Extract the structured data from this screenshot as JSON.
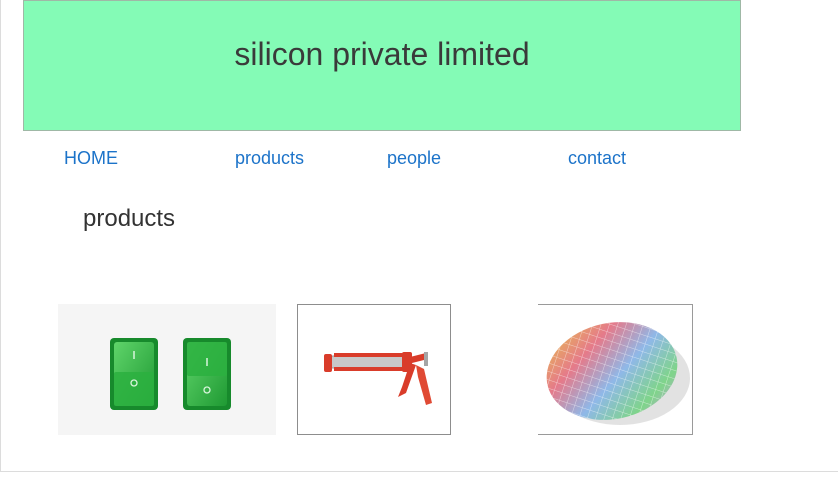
{
  "header": {
    "title": "silicon private limited",
    "background_color": "#84fbb6"
  },
  "nav": {
    "items": [
      {
        "label": "HOME"
      },
      {
        "label": "products"
      },
      {
        "label": "people"
      },
      {
        "label": "contact"
      }
    ],
    "link_color": "#1c73c9"
  },
  "main": {
    "heading": "products",
    "products": [
      {
        "icon": "rocker-switches-icon"
      },
      {
        "icon": "caulking-gun-icon"
      },
      {
        "icon": "silicon-wafer-icon"
      }
    ]
  }
}
